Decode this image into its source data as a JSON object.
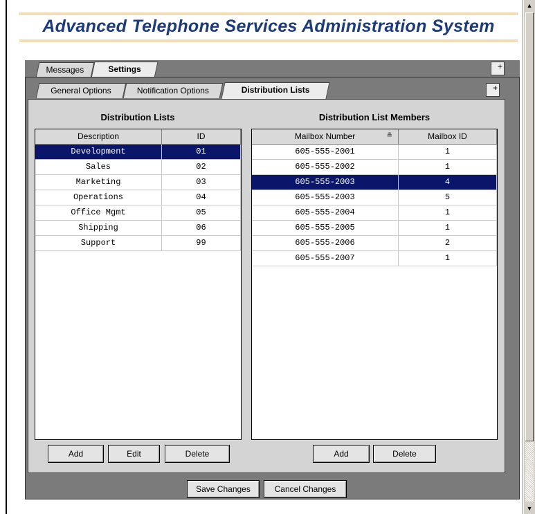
{
  "app": {
    "title": "Advanced Telephone Services Administration System"
  },
  "main_tabs": [
    {
      "label": "Messages",
      "active": false
    },
    {
      "label": "Settings",
      "active": true
    }
  ],
  "settings_tabs": [
    {
      "label": "General Options",
      "active": false
    },
    {
      "label": "Notification Options",
      "active": false
    },
    {
      "label": "Distribution Lists",
      "active": true
    }
  ],
  "distribution_lists": {
    "title": "Distribution Lists",
    "columns": [
      "Description",
      "ID"
    ],
    "rows": [
      {
        "description": "Development",
        "id": "01",
        "selected": true
      },
      {
        "description": "Sales",
        "id": "02",
        "selected": false
      },
      {
        "description": "Marketing",
        "id": "03",
        "selected": false
      },
      {
        "description": "Operations",
        "id": "04",
        "selected": false
      },
      {
        "description": "Office Mgmt",
        "id": "05",
        "selected": false
      },
      {
        "description": "Shipping",
        "id": "06",
        "selected": false
      },
      {
        "description": "Support",
        "id": "99",
        "selected": false
      }
    ],
    "buttons": {
      "add": "Add",
      "edit": "Edit",
      "delete": "Delete"
    }
  },
  "members": {
    "title": "Distribution List Members",
    "columns": [
      "Mailbox Number",
      "Mailbox ID"
    ],
    "sort_icon": "sort-icon",
    "rows": [
      {
        "mailbox": "605-555-2001",
        "id": "1",
        "selected": false
      },
      {
        "mailbox": "605-555-2002",
        "id": "1",
        "selected": false
      },
      {
        "mailbox": "605-555-2003",
        "id": "4",
        "selected": true
      },
      {
        "mailbox": "605-555-2003",
        "id": "5",
        "selected": false
      },
      {
        "mailbox": "605-555-2004",
        "id": "1",
        "selected": false
      },
      {
        "mailbox": "605-555-2005",
        "id": "1",
        "selected": false
      },
      {
        "mailbox": "605-555-2006",
        "id": "2",
        "selected": false
      },
      {
        "mailbox": "605-555-2007",
        "id": "1",
        "selected": false
      }
    ],
    "buttons": {
      "add": "Add",
      "delete": "Delete"
    }
  },
  "footer": {
    "save": "Save Changes",
    "cancel": "Cancel Changes"
  },
  "colors": {
    "title": "#1c3b78",
    "selection": "#0a166a",
    "panel": "#7b7b7b"
  },
  "scrollbar": {
    "up_icon": "▲",
    "down_icon": "▼"
  },
  "expand_icon": "+"
}
